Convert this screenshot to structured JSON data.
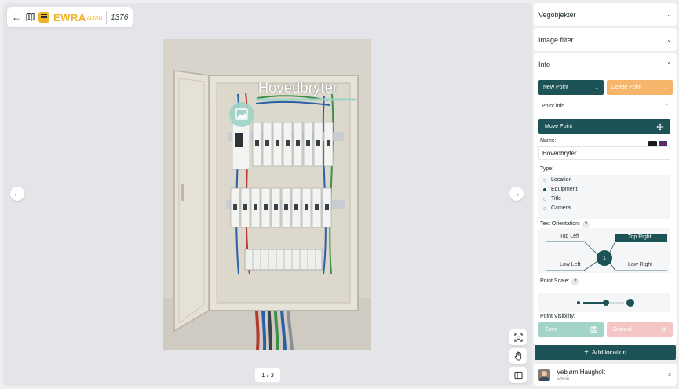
{
  "app": {
    "logo_text": "EWRA",
    "logo_suffix": "ADMIN",
    "project_id": "1376"
  },
  "viewer": {
    "point_label": "Hovedbryter",
    "pager": "1 / 3",
    "tools": [
      "focus-icon",
      "hand-icon",
      "sidebar-icon"
    ]
  },
  "sidebar": {
    "sections": [
      {
        "label": "Vegobjekter"
      },
      {
        "label": "Image filter"
      }
    ],
    "info": {
      "label": "Info",
      "new_point": "New Point",
      "delete_point": "Delete Point",
      "point_info": "Point info",
      "move_point": "Move Point",
      "name_label": "Name:",
      "name_value": "Hovedbryter",
      "type_label": "Type:",
      "types": [
        {
          "label": "Location",
          "selected": false
        },
        {
          "label": "Equipment",
          "selected": true
        },
        {
          "label": "Title",
          "selected": false
        },
        {
          "label": "Camera",
          "selected": false
        }
      ],
      "orientation_label": "Text Orientation:",
      "orientation_help": "?",
      "orientations": {
        "top_left": "Top Left",
        "top_right": "Top Right",
        "low_left": "Low Left",
        "low_right": "Low Right",
        "selected": "Top Right",
        "center": "1"
      },
      "scale_label": "Point Scale:",
      "scale_help": "?",
      "scale_level": 0.55,
      "visibility_label": "Point Visibility:",
      "save": "Save",
      "discard": "Discard"
    },
    "add_location": "Add location",
    "user": {
      "name": "Vebjørn Haugholt",
      "role": "admin"
    }
  },
  "colors": {
    "primary": "#1d5256",
    "accent": "#f0b429",
    "delete": "#f6b56a",
    "save_disabled": "#a3d4c8",
    "discard_disabled": "#f4c5c5"
  }
}
